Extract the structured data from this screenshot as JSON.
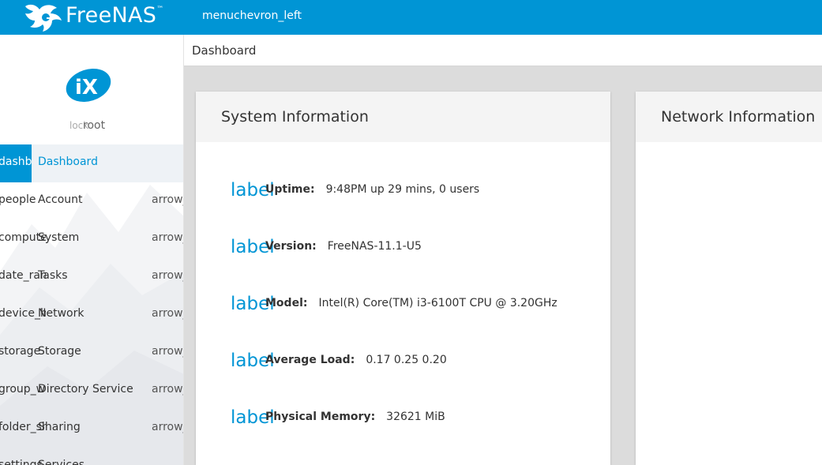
{
  "topbar": {
    "brand_name": "FreeNAS",
    "brand_tm": "™",
    "menu_toggle_label": "menuchevron_left",
    "accent_color": "#0095d5"
  },
  "sidebar": {
    "user": {
      "icon_text": "lock",
      "name": "root"
    },
    "items": [
      {
        "icon": "dashboard",
        "label": "Dashboard",
        "arrow": "",
        "active": true
      },
      {
        "icon": "people",
        "label": "Account",
        "arrow": "arrow_right"
      },
      {
        "icon": "computer",
        "label": "System",
        "arrow": "arrow_right"
      },
      {
        "icon": "date_range",
        "label": "Tasks",
        "arrow": "arrow_right"
      },
      {
        "icon": "device_hub",
        "label": "Network",
        "arrow": "arrow_right"
      },
      {
        "icon": "storage",
        "label": "Storage",
        "arrow": "arrow_right"
      },
      {
        "icon": "group_work",
        "label": "Directory Service",
        "arrow": "arrow_right"
      },
      {
        "icon": "folder_shared",
        "label": "Sharing",
        "arrow": "arrow_right"
      },
      {
        "icon": "settings",
        "label": "Services",
        "arrow": ""
      }
    ]
  },
  "breadcrumb": {
    "current": "Dashboard"
  },
  "system_card": {
    "title": "System Information",
    "rows": [
      {
        "icon": "label",
        "key": "Uptime:",
        "value": "9:48PM up 29 mins, 0 users"
      },
      {
        "icon": "label",
        "key": "Version:",
        "value": "FreeNAS-11.1-U5"
      },
      {
        "icon": "label",
        "key": "Model:",
        "value": "Intel(R) Core(TM) i3-6100T CPU @ 3.20GHz"
      },
      {
        "icon": "label",
        "key": "Average Load:",
        "value": "0.17 0.25 0.20"
      },
      {
        "icon": "label",
        "key": "Physical Memory:",
        "value": "32621 MiB"
      }
    ]
  },
  "network_card": {
    "title": "Network Information"
  }
}
